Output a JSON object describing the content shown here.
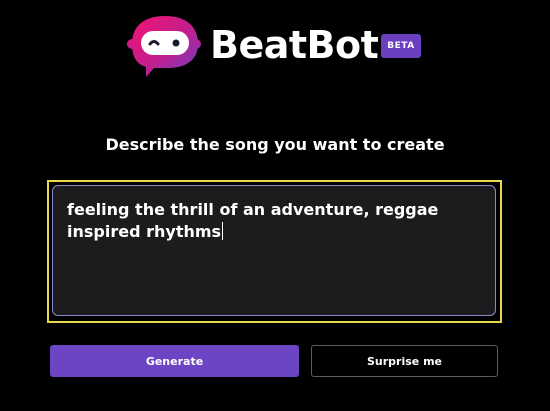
{
  "header": {
    "brand_name": "BeatBot",
    "badge": "BETA",
    "logo_icon": "robot-chat-bubble-icon"
  },
  "main": {
    "heading": "Describe the song you want to create",
    "prompt_value": "feeling the thrill of an adventure, reggae inspired rhythms",
    "generate_label": "Generate",
    "surprise_label": "Surprise me"
  },
  "colors": {
    "background": "#000000",
    "accent": "#6b45c4",
    "focus_ring": "#e8d84a",
    "textarea_bg": "#1c1c1f",
    "logo_gradient_start": "#e91e63",
    "logo_gradient_end": "#6a3fc2"
  }
}
